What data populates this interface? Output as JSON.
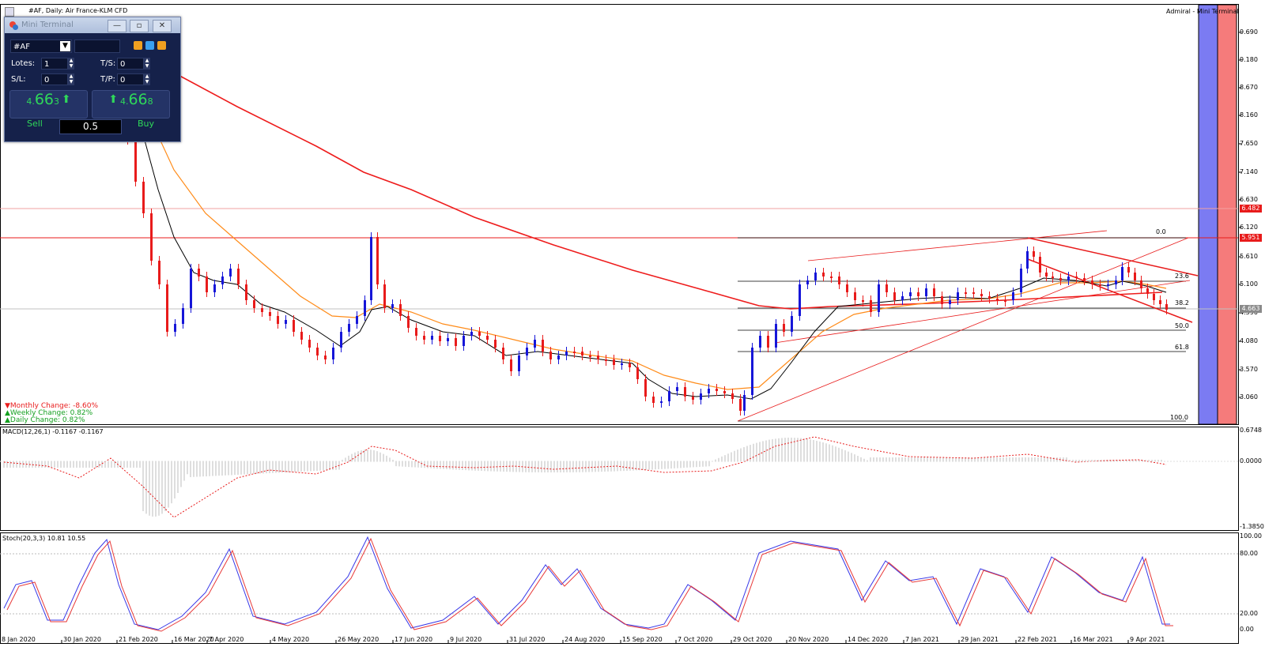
{
  "chart_header": {
    "title": "#AF, Daily:  Air France-KLM CFD",
    "right_label": "Admiral - Mini Terminal"
  },
  "mini_terminal": {
    "title": "Mini Terminal",
    "symbol": "#AF",
    "lots_label": "Lotes:",
    "lots_value": "1",
    "ts_label": "T/S:",
    "ts_value": "0",
    "sl_label": "S/L:",
    "sl_value": "0",
    "tp_label": "T/P:",
    "tp_value": "0",
    "sell_price_small": "4.",
    "sell_price_big": "66",
    "sell_price_tail": "3",
    "buy_price_small": "4.",
    "buy_price_big": "66",
    "buy_price_tail": "8",
    "sell_label": "Sell",
    "buy_label": "Buy",
    "lot_size": "0.5"
  },
  "changes": {
    "monthly": "Monthly Change: -8.60%",
    "weekly": "Weekly Change: 0.82%",
    "daily": "Daily Change: 0.82%"
  },
  "price_axis": [
    "9.690",
    "9.180",
    "8.670",
    "8.160",
    "7.650",
    "7.140",
    "6.630",
    "6.120",
    "5.610",
    "5.100",
    "4.590",
    "4.080",
    "3.570",
    "3.060"
  ],
  "price_tags": {
    "upper": "6.482",
    "lower": "5.951",
    "current": "4.663"
  },
  "fib_labels": [
    "0.0",
    "23.6",
    "38.2",
    "50.0",
    "61.8",
    "100.0"
  ],
  "macd": {
    "label": "MACD(12,26,1) -0.1167 -0.1167",
    "axis": [
      "0.6748",
      "0.0000",
      "-1.3850"
    ]
  },
  "stoch": {
    "label": "Stoch(20,3,3) 10.81 10.55",
    "axis": [
      "100.00",
      "80.00",
      "20.00",
      "0.00"
    ]
  },
  "date_axis": [
    "8 Jan 2020",
    "30 Jan 2020",
    "21 Feb 2020",
    "16 Mar 2020",
    "7 Apr 2020",
    "4 May 2020",
    "26 May 2020",
    "17 Jun 2020",
    "9 Jul 2020",
    "31 Jul 2020",
    "24 Aug 2020",
    "15 Sep 2020",
    "7 Oct 2020",
    "29 Oct 2020",
    "20 Nov 2020",
    "14 Dec 2020",
    "7 Jan 2021",
    "29 Jan 2021",
    "22 Feb 2021",
    "16 Mar 2021",
    "9 Apr 2021"
  ],
  "colors": {
    "bull": "#1616d8",
    "bear": "#e81b1b",
    "ma200": "#ee1c1c",
    "ma_orange": "#ff8c1a",
    "ma_black": "#000000",
    "panel_blue": "#7b7bf2",
    "panel_red": "#f57b7b"
  }
}
